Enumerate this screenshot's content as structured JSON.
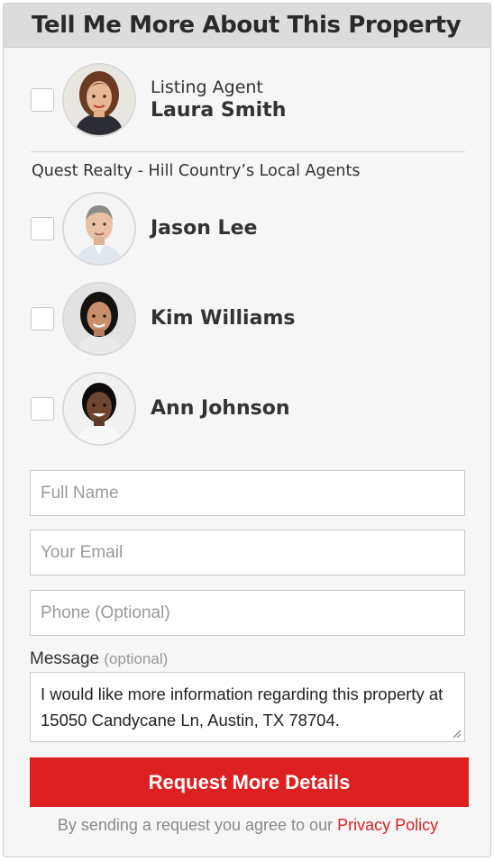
{
  "form": {
    "title": "Tell Me More About This Property",
    "listing_agent": {
      "role": "Listing Agent",
      "name": "Laura Smith"
    },
    "company": "Quest Realty - Hill Country’s Local Agents",
    "agents": [
      {
        "name": "Jason Lee"
      },
      {
        "name": "Kim Williams"
      },
      {
        "name": "Ann Johnson"
      }
    ],
    "fields": {
      "full_name_placeholder": "Full Name",
      "email_placeholder": "Your Email",
      "phone_placeholder": "Phone (Optional)"
    },
    "message": {
      "label": "Message",
      "optional": "(optional)",
      "value": "I would like more information regarding this property at 15050 Candycane Ln, Austin, TX 78704."
    },
    "submit_label": "Request More Details",
    "disclaimer_text": "By sending a request you agree to our",
    "privacy_link": "Privacy Policy"
  },
  "colors": {
    "accent": "#dd2121",
    "header_bg": "#dcdcdc",
    "card_bg": "#f6f6f6"
  }
}
